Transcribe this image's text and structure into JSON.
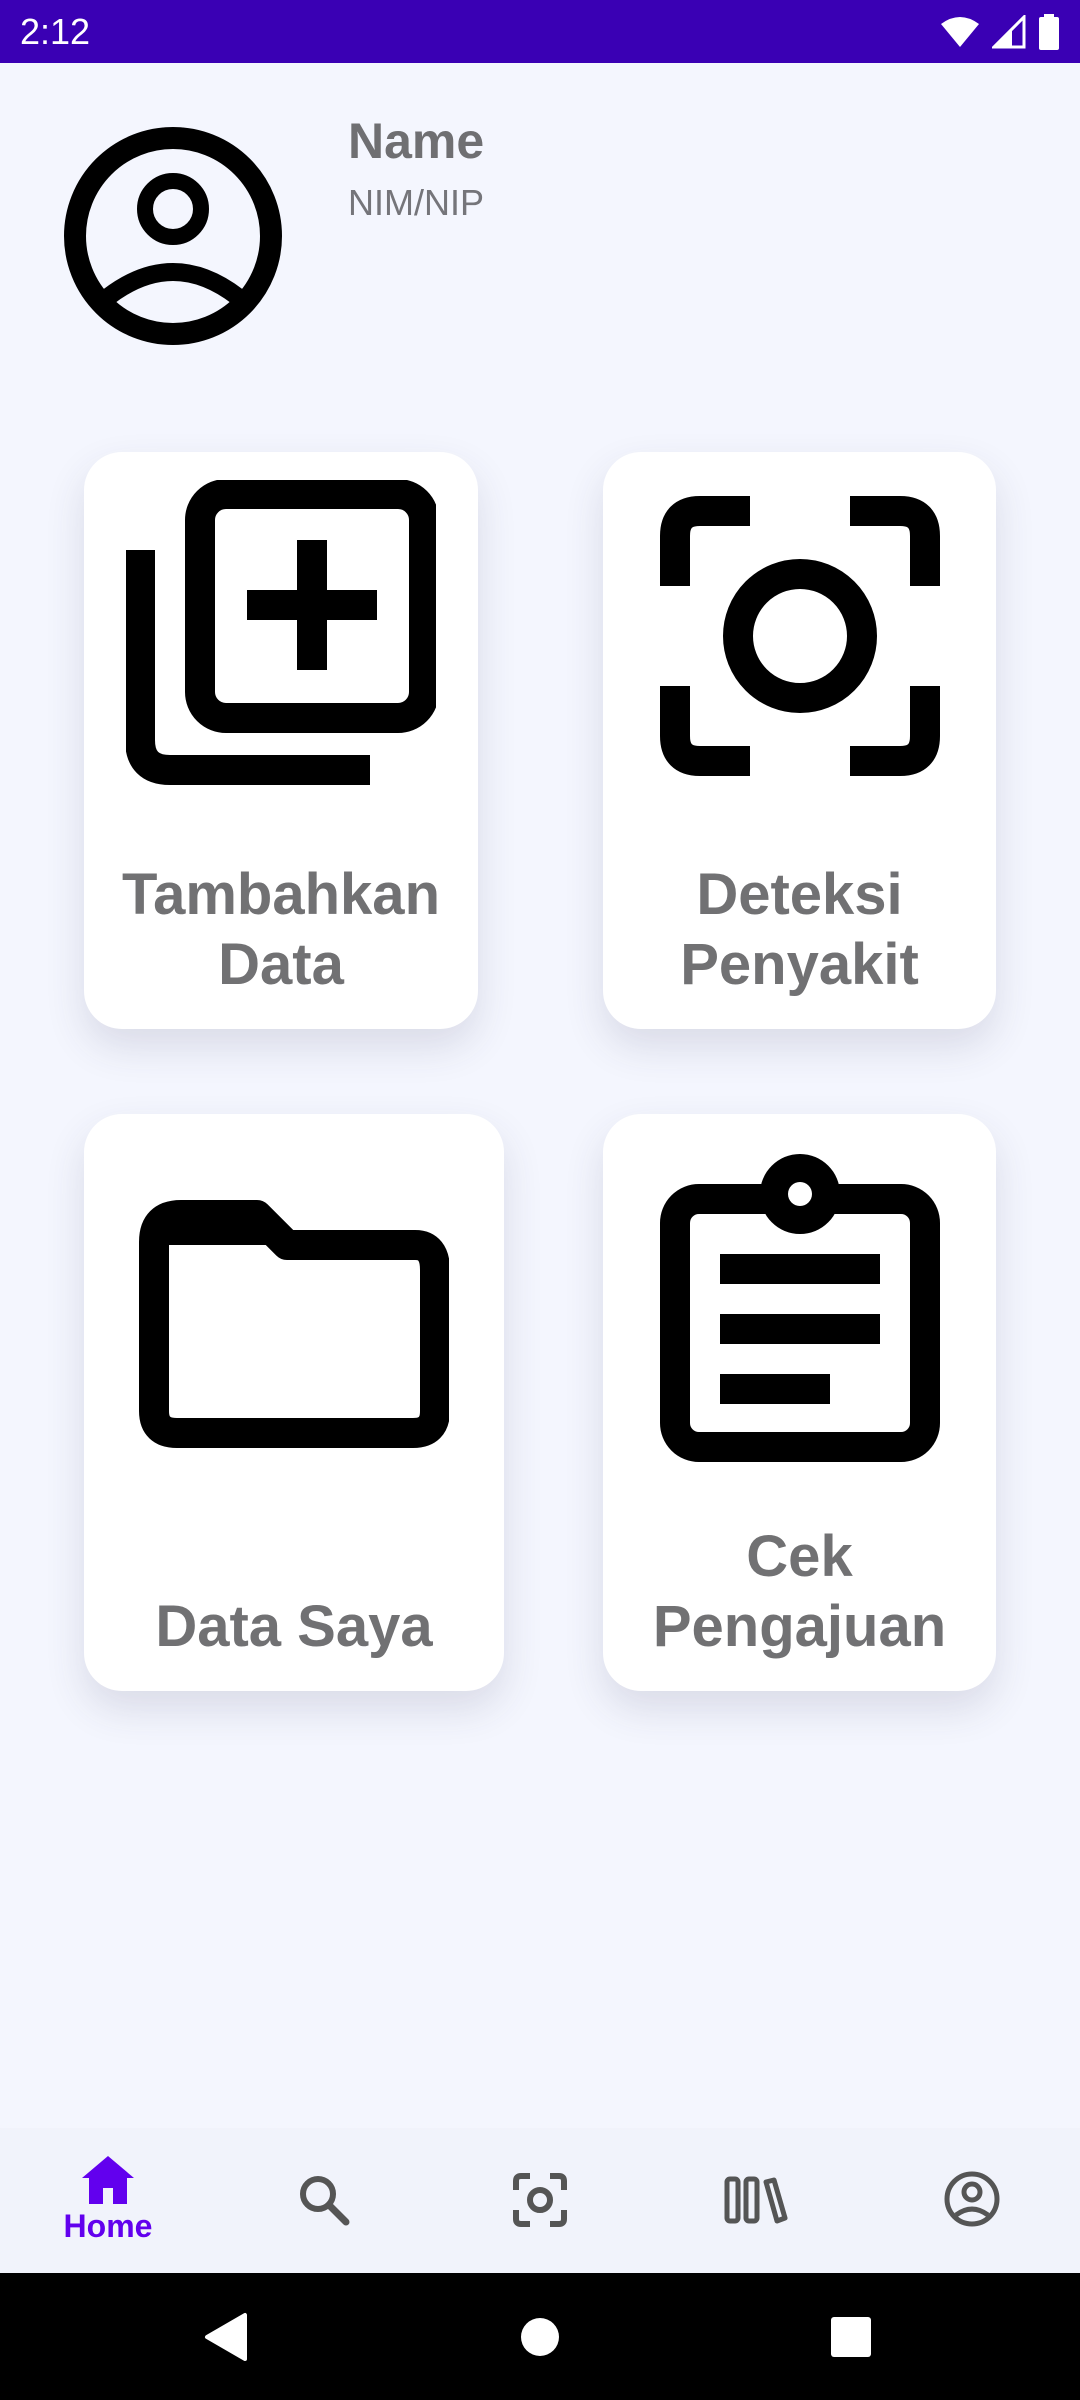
{
  "status_bar": {
    "time": "2:12",
    "icons": [
      "wifi-icon",
      "cell-signal-icon",
      "battery-icon"
    ],
    "background": "#3a00b4"
  },
  "profile": {
    "name": "Name",
    "id_label": "NIM/NIP",
    "avatar_icon": "account-circle-icon"
  },
  "menu": {
    "items": [
      {
        "label_line1": "Tambahkan",
        "label_line2": "Data",
        "icon": "add-to-library-icon"
      },
      {
        "label_line1": "Deteksi",
        "label_line2": "Penyakit",
        "icon": "camera-focus-icon"
      },
      {
        "label_line1": "Data Saya",
        "label_line2": "",
        "icon": "folder-icon"
      },
      {
        "label_line1": "Cek",
        "label_line2": "Pengajuan",
        "icon": "clipboard-icon"
      }
    ]
  },
  "bottom_nav": {
    "accent": "#6200ee",
    "items": [
      {
        "label": "Home",
        "icon": "home-icon",
        "selected": true
      },
      {
        "label": "",
        "icon": "search-icon",
        "selected": false
      },
      {
        "label": "",
        "icon": "camera-focus-icon",
        "selected": false
      },
      {
        "label": "",
        "icon": "library-icon",
        "selected": false
      },
      {
        "label": "",
        "icon": "account-circle-icon",
        "selected": false
      }
    ]
  },
  "system_nav": {
    "icons": [
      "back-icon",
      "home-circle-icon",
      "recents-icon"
    ]
  }
}
